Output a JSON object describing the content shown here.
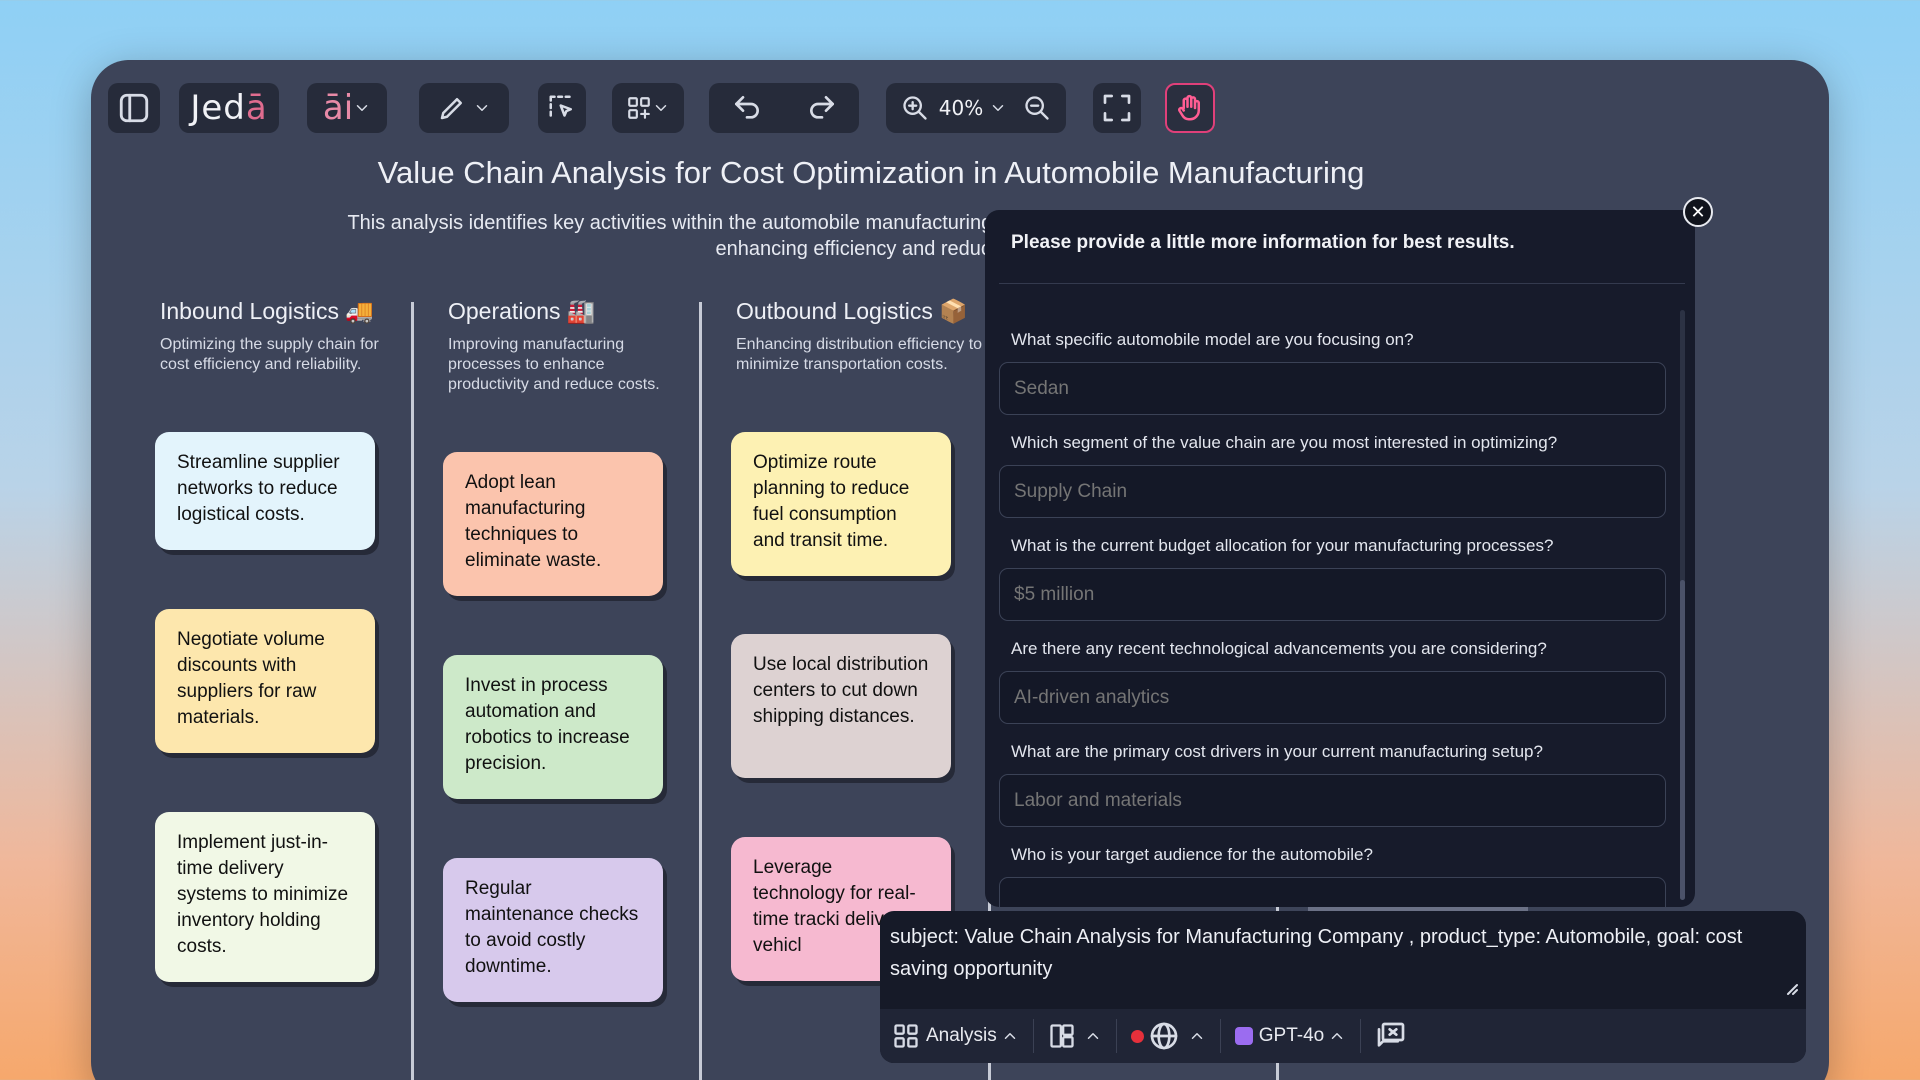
{
  "toolbar": {
    "logo_main": "Jed",
    "logo_accent": "ā",
    "ai_label": "āi",
    "zoom": "40%"
  },
  "canvas": {
    "title": "Value Chain Analysis for Cost Optimization in Automobile Manufacturing",
    "subtitle_line1": "This analysis identifies key activities within the automobile manufacturing value chain v",
    "subtitle_line2": "enhancing efficiency and reducin",
    "columns": [
      {
        "title": "Inbound Logistics",
        "emoji": "🚚",
        "description": "Optimizing the supply chain for cost efficiency and reliability.",
        "notes": [
          {
            "text": "Streamline supplier networks to reduce logistical costs.",
            "color": "#e3f4fc"
          },
          {
            "text": "Negotiate volume discounts with suppliers for raw materials.",
            "color": "#fde7ad"
          },
          {
            "text": "Implement just-in-time delivery systems to minimize inventory holding costs.",
            "color": "#f1f8e6"
          }
        ]
      },
      {
        "title": "Operations",
        "emoji": "🏭",
        "description": "Improving manufacturing processes to enhance productivity and reduce costs.",
        "notes": [
          {
            "text": "Adopt lean manufacturing techniques to eliminate waste.",
            "color": "#fbc4ad"
          },
          {
            "text": "Invest in process automation and robotics to increase precision.",
            "color": "#cde9c9"
          },
          {
            "text": "Regular maintenance checks to avoid costly downtime.",
            "color": "#d7c9ec"
          }
        ]
      },
      {
        "title": "Outbound Logistics",
        "emoji": "📦",
        "description": "Enhancing distribution efficiency to minimize transportation costs.",
        "notes": [
          {
            "text": "Optimize route planning to reduce fuel consumption and transit time.",
            "color": "#fdf1b3"
          },
          {
            "text": "Use local distribution centers to cut down shipping distances.",
            "color": "#ddd2d2"
          },
          {
            "text": "Leverage technology for real-time tracki delivery vehicl",
            "color": "#f6b9d0"
          }
        ]
      }
    ]
  },
  "dialog": {
    "heading": "Please provide a little more information for best results.",
    "questions": [
      {
        "q": "What specific automobile model are you focusing on?",
        "placeholder": "Sedan"
      },
      {
        "q": "Which segment of the value chain are you most interested in optimizing?",
        "placeholder": "Supply Chain"
      },
      {
        "q": "What is the current budget allocation for your manufacturing processes?",
        "placeholder": "$5 million"
      },
      {
        "q": "Are there any recent technological advancements you are considering?",
        "placeholder": "AI-driven analytics"
      },
      {
        "q": "What are the primary cost drivers in your current manufacturing setup?",
        "placeholder": "Labor and materials"
      },
      {
        "q": "Who is your target audience for the automobile?",
        "placeholder": ""
      }
    ]
  },
  "prompt": {
    "text": "subject: Value Chain Analysis for Manufacturing Company , product_type: Automobile, goal: cost saving opportunity",
    "mode_label": "Analysis",
    "model_label": "GPT-4o",
    "record_color": "#e5303b",
    "model_icon_color": "#9b6cf0"
  },
  "icons": [
    "sidebar-icon",
    "pen-icon",
    "select-icon",
    "grid-icon",
    "undo-icon",
    "redo-icon",
    "zoom-in-icon",
    "zoom-out-icon",
    "fullscreen-icon",
    "hand-icon",
    "close-icon",
    "analysis-icon",
    "layout-icon",
    "globe-icon",
    "chat-icon"
  ]
}
